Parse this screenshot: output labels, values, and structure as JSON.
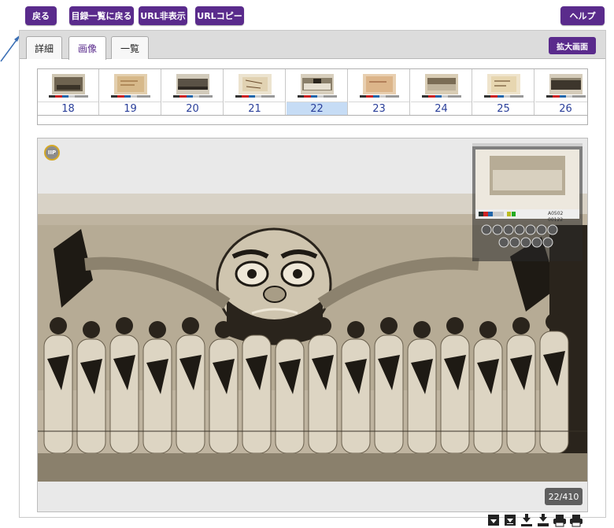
{
  "toolbar": {
    "back_label": "戻る",
    "back_to_list_label": "目録一覧に戻る",
    "hide_url_label": "URL非表示",
    "copy_url_label": "URLコピー",
    "help_label": "ヘルプ"
  },
  "tabs": [
    {
      "label": "詳細"
    },
    {
      "label": "画像"
    },
    {
      "label": "一覧"
    }
  ],
  "zoom_button_label": "拡大画面",
  "thumbnails": [
    {
      "number": "18"
    },
    {
      "number": "19"
    },
    {
      "number": "20"
    },
    {
      "number": "21"
    },
    {
      "number": "22"
    },
    {
      "number": "23"
    },
    {
      "number": "24"
    },
    {
      "number": "25"
    },
    {
      "number": "26"
    }
  ],
  "selected_thumbnail": "22",
  "viewer": {
    "logo_text": "IIP",
    "page_counter": "22/410",
    "minimap_label": "A0502 00122"
  },
  "colors": {
    "accent": "#5a2b8c",
    "selected_thumb": "#c6dcf5",
    "thumb_number": "#2a3f9a"
  },
  "icons": [
    "download-icon",
    "download-page-icon",
    "download-all-icon",
    "save-icon",
    "print-icon",
    "print-all-icon"
  ]
}
